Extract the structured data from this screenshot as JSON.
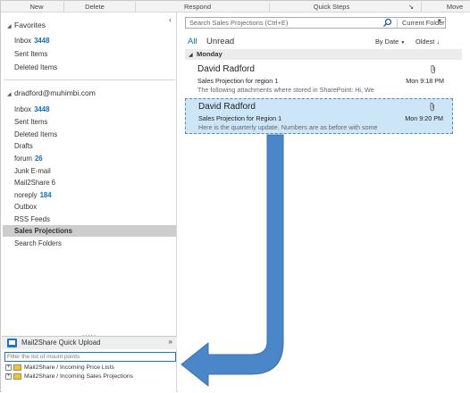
{
  "ribbon": {
    "groups": [
      "New",
      "Delete",
      "Respond",
      "Quick Steps",
      "Move"
    ],
    "launcher": "↘"
  },
  "nav": {
    "collapse": "‹",
    "favorites": {
      "header": "Favorites",
      "items": [
        {
          "label": "Inbox",
          "count": "3448"
        },
        {
          "label": "Sent Items",
          "count": ""
        },
        {
          "label": "Deleted Items",
          "count": ""
        }
      ]
    },
    "account": {
      "header": "dradford@muhimbi.com",
      "items": [
        {
          "label": "Inbox",
          "count": "3448"
        },
        {
          "label": "Sent Items",
          "count": ""
        },
        {
          "label": "Deleted Items",
          "count": ""
        },
        {
          "label": "Drafts",
          "count": ""
        },
        {
          "label": "forum",
          "count": "26"
        },
        {
          "label": "Junk E-mail",
          "count": ""
        },
        {
          "label": "Mail2Share 6",
          "count": ""
        },
        {
          "label": "noreply",
          "count": "184"
        },
        {
          "label": "Outbox",
          "count": ""
        },
        {
          "label": "RSS Feeds",
          "count": ""
        },
        {
          "label": "Sales Projections",
          "count": ""
        },
        {
          "label": "Search Folders",
          "count": ""
        }
      ]
    },
    "selected_label": "Sales Projections",
    "splitter": "....."
  },
  "mail2share": {
    "title": "Mail2Share Quick Upload",
    "collapse": "»",
    "filter_placeholder": "Filter the list of mount points",
    "mounts": [
      "Mail2Share / Incoming Price Lists",
      "Mail2Share / Incoming Sales Projections"
    ]
  },
  "list": {
    "search_placeholder": "Search Sales Projections (Ctrl+E)",
    "scope": "Current Folder",
    "tabs": [
      "All",
      "Unread"
    ],
    "sort_by": "By Date",
    "order": "Oldest",
    "group_header": "Monday",
    "messages": [
      {
        "from": "David Radford",
        "subject": "Sales Projection for region 1",
        "time": "Mon 9:18 PM",
        "preview": "The following attachments where stored in SharePoint:  Hi,  We",
        "attachment": true,
        "selected": false
      },
      {
        "from": "David Radford",
        "subject": "Sales Projection for Region 1",
        "time": "Mon 9:20 PM",
        "preview": "Here is the quarterly update.  Numbers are as before with some",
        "attachment": true,
        "selected": true
      }
    ]
  },
  "colors": {
    "accent": "#0f6fc6",
    "selection": "#cde6f7",
    "arrow": "#4a86c8"
  }
}
